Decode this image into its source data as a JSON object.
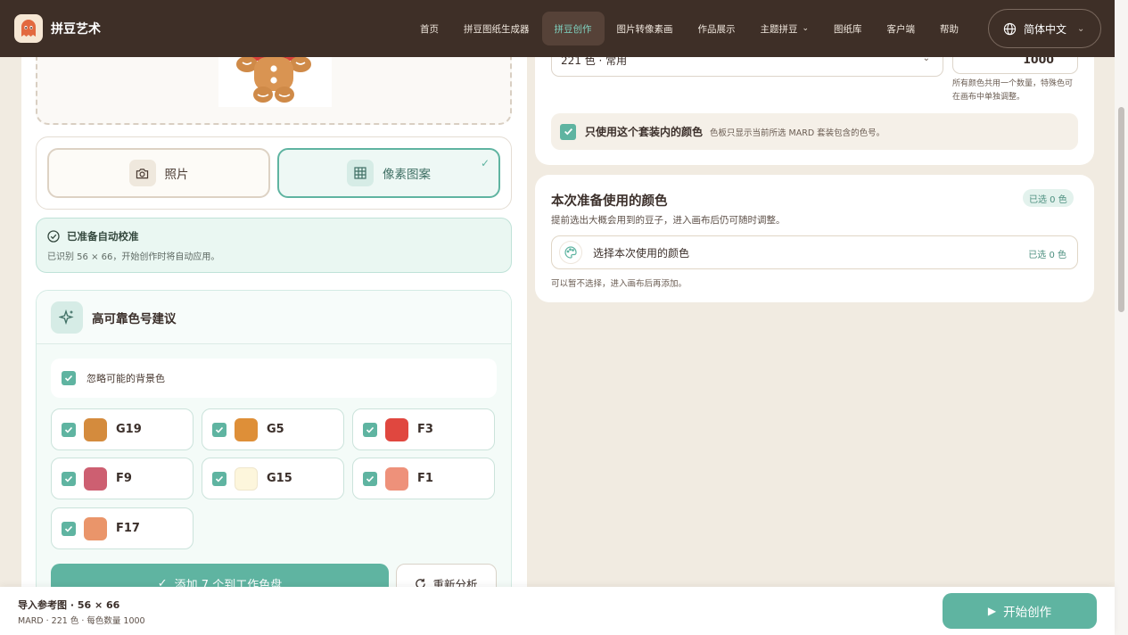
{
  "brand": {
    "name": "拼豆艺术"
  },
  "nav": {
    "items": [
      {
        "label": "首页"
      },
      {
        "label": "拼豆图纸生成器"
      },
      {
        "label": "拼豆创作"
      },
      {
        "label": "图片转像素画"
      },
      {
        "label": "作品展示"
      },
      {
        "label": "主题拼豆"
      },
      {
        "label": "图纸库"
      },
      {
        "label": "客户端"
      },
      {
        "label": "帮助"
      }
    ],
    "active_index": 2,
    "language": "简体中文"
  },
  "left": {
    "mode": {
      "photo_label": "照片",
      "pixel_label": "像素图案",
      "selected": "像素图案"
    },
    "calibration": {
      "title": "已准备自动校准",
      "subtitle": "已识别 56 × 66，开始创作时将自动应用。"
    },
    "suggestions": {
      "title": "高可靠色号建议",
      "ignore_bg_label": "忽略可能的背景色",
      "colors": [
        {
          "code": "G19",
          "hex": "#d48b3d"
        },
        {
          "code": "G5",
          "hex": "#de8f38"
        },
        {
          "code": "F3",
          "hex": "#e0473f"
        },
        {
          "code": "F9",
          "hex": "#cd5f71"
        },
        {
          "code": "G15",
          "hex": "#fdf6dc"
        },
        {
          "code": "F1",
          "hex": "#ee917a"
        },
        {
          "code": "F17",
          "hex": "#ea956a"
        }
      ],
      "add_button": "添加 7 个到工作色盘",
      "reanalyze_button": "重新分析"
    }
  },
  "right": {
    "palette_select": "221 色 · 常用",
    "quantity": "1000",
    "quantity_note": "所有颜色共用一个数量，特殊色可在画布中单独调整。",
    "only_set": {
      "title": "只使用这个套装内的颜色",
      "desc": "色板只显示当前所选 MARD 套装包含的色号。"
    },
    "colors_card": {
      "title": "本次准备使用的颜色",
      "badge": "已选 0 色",
      "subtitle": "提前选出大概会用到的豆子，进入画布后仍可随时调整。",
      "pick_label": "选择本次使用的颜色",
      "pick_count": "已选 0 色",
      "note": "可以暂不选择，进入画布后再添加。"
    }
  },
  "bottom": {
    "title": "导入参考图 · 56 × 66",
    "subtitle": "MARD · 221 色 · 每色数量 1000",
    "start_button": "开始创作"
  },
  "colors": {
    "topbar": "#3e2f27",
    "accent": "#5fb4a1",
    "background": "#f1ebe1"
  }
}
